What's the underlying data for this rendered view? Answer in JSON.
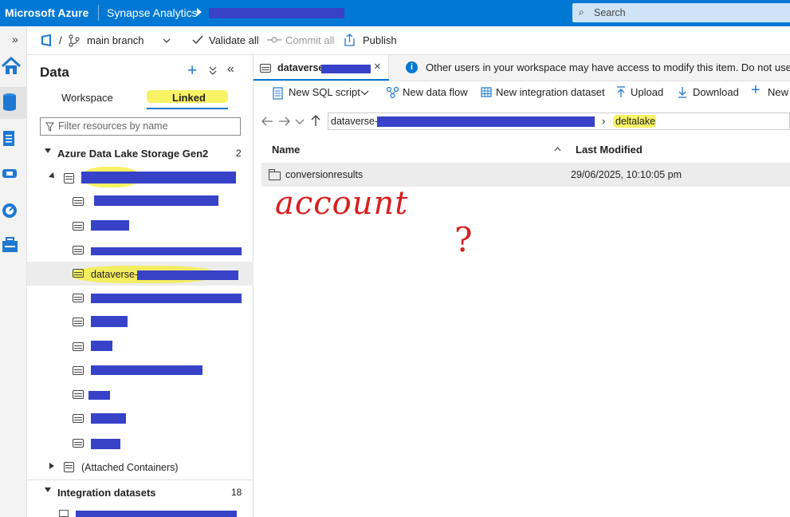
{
  "topbar": {
    "brand": "Microsoft Azure",
    "app": "Synapse Analytics",
    "search_placeholder": "Search"
  },
  "toolbar": {
    "branch": "main branch",
    "validate": "Validate all",
    "commit": "Commit all",
    "publish": "Publish",
    "slash": "/"
  },
  "data_panel": {
    "title": "Data",
    "tabs": [
      "Workspace",
      "Linked"
    ],
    "active_tab": "Linked",
    "filter_placeholder": "Filter resources by name",
    "sections": [
      {
        "label": "Azure Data Lake Storage Gen2",
        "count": "2"
      },
      {
        "label": "Integration datasets",
        "count": "18"
      }
    ],
    "selected_item": "dataverse-",
    "attached": "(Attached Containers)"
  },
  "editor": {
    "tab_title": "dataverse-",
    "info_text": "Other users in your workspace may have access to modify this item. Do not use this i",
    "actions": [
      "New SQL script",
      "New data flow",
      "New integration dataset",
      "Upload",
      "Download",
      "New"
    ],
    "path_root": "dataverse-",
    "path_leaf": "deltalake",
    "columns": [
      "Name",
      "Last Modified"
    ],
    "rows": [
      {
        "name": "conversionresults",
        "modified": "29/06/2025, 10:10:05 pm"
      }
    ]
  },
  "annotations": {
    "handwriting": "account",
    "question": "?"
  },
  "colors": {
    "azure_blue": "#0078d4",
    "redaction": "#3742c9",
    "highlight": "#f5ee31",
    "pen": "#d91e1e"
  }
}
